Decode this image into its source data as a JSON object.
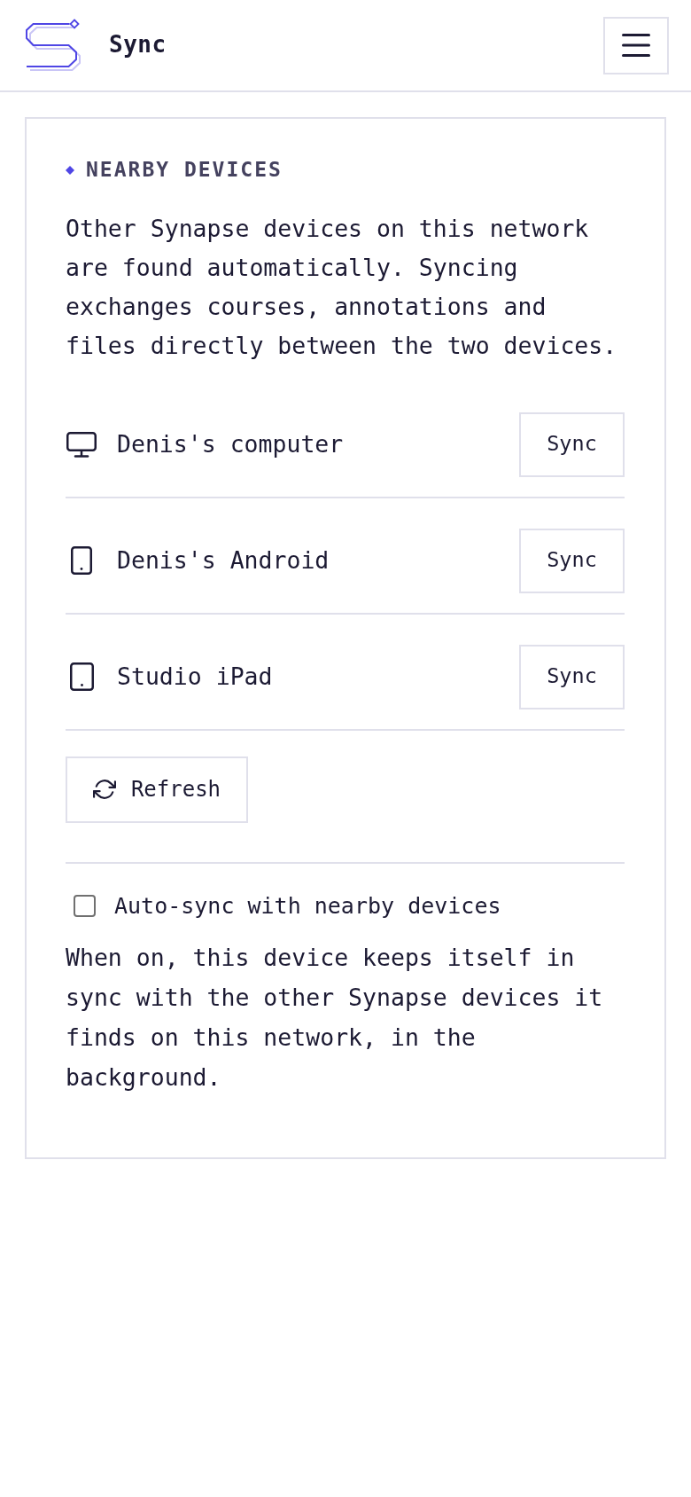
{
  "header": {
    "title": "Sync"
  },
  "section": {
    "title": "NEARBY DEVICES",
    "description": "Other Synapse devices on this network are found automatically. Syncing exchanges courses, annotations and files directly between the two devices."
  },
  "devices": [
    {
      "kind": "computer",
      "name": "Denis's computer",
      "action": "Sync"
    },
    {
      "kind": "phone",
      "name": "Denis's Android",
      "action": "Sync"
    },
    {
      "kind": "tablet",
      "name": "Studio iPad",
      "action": "Sync"
    }
  ],
  "refresh_button": "Refresh",
  "auto_sync": {
    "label": "Auto-sync with nearby devices",
    "checked": false,
    "description": "When on, this device keeps itself in sync with the other Synapse devices it finds on this network, in the background."
  }
}
